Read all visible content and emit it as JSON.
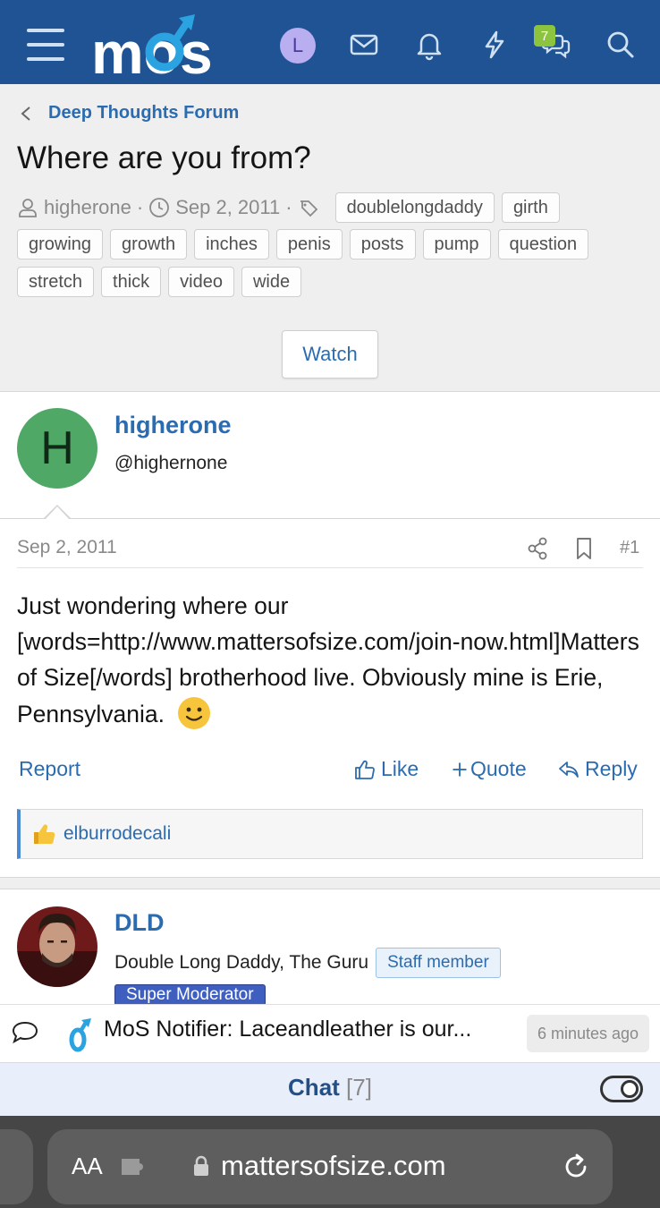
{
  "header": {
    "logo_text": "mos",
    "avatar_letter": "L",
    "icons": [
      "menu-icon",
      "user-avatar",
      "envelope-icon",
      "bell-icon",
      "lightning-icon",
      "chat-bubbles-icon",
      "search-icon"
    ],
    "conversations_badge": "7",
    "colors": {
      "bar": "#1f5394",
      "logo": "#ffffff",
      "logo_accent": "#2aa3e0",
      "badge": "#8cc43f"
    }
  },
  "breadcrumb": {
    "label": "Deep Thoughts Forum"
  },
  "thread": {
    "title": "Where are you from?",
    "author": "higherone",
    "date": "Sep 2, 2011",
    "separator": "·",
    "tags": [
      "doublelongdaddy",
      "girth",
      "growing",
      "growth",
      "inches",
      "penis",
      "posts",
      "pump",
      "question",
      "stretch",
      "thick",
      "video",
      "wide"
    ],
    "watch_label": "Watch"
  },
  "post1": {
    "avatar_letter": "H",
    "username": "higherone",
    "handle": "@highernone",
    "date": "Sep 2, 2011",
    "number": "#1",
    "body": "Just wondering where our [words=http://www.mattersofsize.com/join-now.html]Matters of Size[/words] brotherhood live. Obviously mine is Erie, Pennsylvania.",
    "actions": {
      "report": "Report",
      "like": "Like",
      "quote": "Quote",
      "reply": "Reply"
    },
    "liked_by": "elburrodecali"
  },
  "post2": {
    "username": "DLD",
    "user_title": "Double Long Daddy, The Guru",
    "staff_badge": "Staff member",
    "role_banner": "Super Moderator"
  },
  "notifier": {
    "text": "MoS Notifier: Laceandleather is our...",
    "time": "6 minutes ago"
  },
  "chat": {
    "label": "Chat",
    "count": "[7]"
  },
  "browser": {
    "text_size_label": "AA",
    "url": "mattersofsize.com"
  }
}
